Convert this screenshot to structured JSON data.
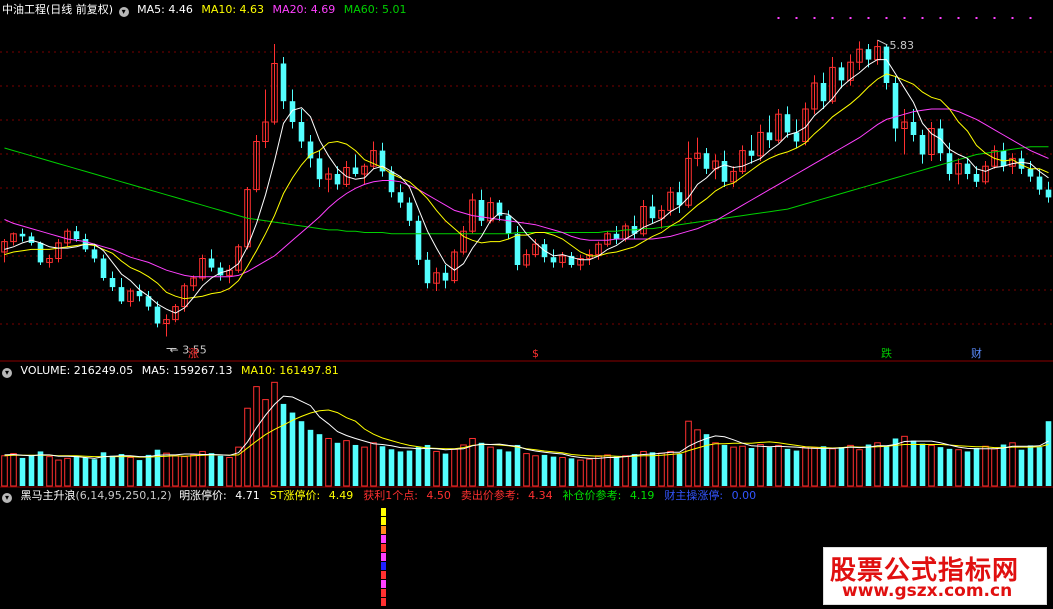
{
  "header": {
    "stock_name": "中油工程",
    "period": "(日线 前复权)",
    "ma5_label": "MA5:",
    "ma5_value": "4.46",
    "ma10_label": "MA10:",
    "ma10_value": "4.63",
    "ma20_label": "MA20:",
    "ma20_value": "4.69",
    "ma60_label": "MA60:",
    "ma60_value": "5.01",
    "high_label": "5.83",
    "low_label": "3.55"
  },
  "markers": [
    {
      "text": "涨",
      "color": "#ff3030"
    },
    {
      "text": "$",
      "color": "#ff3030"
    },
    {
      "text": "跌",
      "color": "#00c800"
    },
    {
      "text": "财",
      "color": "#5a8cff"
    }
  ],
  "volume_header": {
    "label": "VOLUME:",
    "value": "216249.05",
    "ma5_label": "MA5:",
    "ma5_value": "159267.13",
    "ma10_label": "MA10:",
    "ma10_value": "161497.81"
  },
  "indicator_header": {
    "name": "黑马主升浪",
    "params": "(6,14,95,250,1,2)",
    "items": [
      {
        "label": "明涨停价:",
        "value": "4.71",
        "color": "#ffffff"
      },
      {
        "label": "ST涨停价:",
        "value": "4.49",
        "color": "#ffff00"
      },
      {
        "label": "获利1个点:",
        "value": "4.50",
        "color": "#ff3030"
      },
      {
        "label": "卖出价参考:",
        "value": "4.34",
        "color": "#ff3030"
      },
      {
        "label": "补仓价参考:",
        "value": "4.19",
        "color": "#00e000"
      },
      {
        "label": "财主操涨停:",
        "value": "0.00",
        "color": "#3355ff"
      }
    ]
  },
  "watermark": {
    "line1": "股票公式指标网",
    "line2": "www.gszx.com.cn"
  },
  "colors": {
    "up": "#ff3030",
    "down": "#54ffff",
    "ma5": "#ffffff",
    "ma10": "#ffff00",
    "ma20": "#ff40ff",
    "ma60": "#00d000",
    "grid": "#7a0000"
  },
  "chart_data": {
    "type": "candlestick",
    "price_range": [
      3.4,
      6.0
    ],
    "ohlc": [
      [
        4.2,
        4.3,
        4.12,
        4.28
      ],
      [
        4.28,
        4.35,
        4.25,
        4.34
      ],
      [
        4.34,
        4.38,
        4.28,
        4.32
      ],
      [
        4.32,
        4.35,
        4.25,
        4.27
      ],
      [
        4.27,
        4.28,
        4.1,
        4.12
      ],
      [
        4.12,
        4.18,
        4.08,
        4.15
      ],
      [
        4.15,
        4.3,
        4.12,
        4.27
      ],
      [
        4.27,
        4.38,
        4.24,
        4.36
      ],
      [
        4.36,
        4.4,
        4.28,
        4.3
      ],
      [
        4.3,
        4.34,
        4.2,
        4.22
      ],
      [
        4.22,
        4.26,
        4.12,
        4.15
      ],
      [
        4.15,
        4.18,
        3.98,
        4.0
      ],
      [
        4.0,
        4.05,
        3.9,
        3.93
      ],
      [
        3.93,
        4.0,
        3.8,
        3.82
      ],
      [
        3.82,
        3.92,
        3.78,
        3.9
      ],
      [
        3.9,
        3.95,
        3.82,
        3.86
      ],
      [
        3.86,
        3.9,
        3.75,
        3.78
      ],
      [
        3.78,
        3.82,
        3.62,
        3.65
      ],
      [
        3.65,
        3.72,
        3.55,
        3.68
      ],
      [
        3.68,
        3.8,
        3.66,
        3.78
      ],
      [
        3.78,
        3.96,
        3.74,
        3.94
      ],
      [
        3.94,
        4.02,
        3.9,
        4.0
      ],
      [
        4.0,
        4.18,
        3.98,
        4.15
      ],
      [
        4.15,
        4.22,
        4.05,
        4.08
      ],
      [
        4.08,
        4.12,
        3.98,
        4.02
      ],
      [
        4.02,
        4.1,
        3.96,
        4.06
      ],
      [
        4.06,
        4.26,
        4.04,
        4.24
      ],
      [
        4.24,
        4.7,
        4.22,
        4.68
      ],
      [
        4.68,
        5.1,
        4.66,
        5.05
      ],
      [
        5.05,
        5.45,
        5.0,
        5.2
      ],
      [
        5.2,
        5.8,
        5.18,
        5.65
      ],
      [
        5.65,
        5.7,
        5.3,
        5.36
      ],
      [
        5.36,
        5.45,
        5.15,
        5.2
      ],
      [
        5.2,
        5.3,
        5.0,
        5.05
      ],
      [
        5.05,
        5.1,
        4.85,
        4.92
      ],
      [
        4.92,
        4.98,
        4.7,
        4.76
      ],
      [
        4.76,
        4.85,
        4.66,
        4.8
      ],
      [
        4.8,
        4.86,
        4.68,
        4.72
      ],
      [
        4.72,
        4.9,
        4.7,
        4.85
      ],
      [
        4.85,
        4.95,
        4.78,
        4.8
      ],
      [
        4.8,
        4.88,
        4.72,
        4.86
      ],
      [
        4.86,
        5.05,
        4.84,
        4.98
      ],
      [
        4.98,
        5.04,
        4.78,
        4.82
      ],
      [
        4.82,
        4.86,
        4.62,
        4.66
      ],
      [
        4.66,
        4.72,
        4.54,
        4.58
      ],
      [
        4.58,
        4.62,
        4.4,
        4.44
      ],
      [
        4.44,
        4.48,
        4.1,
        4.14
      ],
      [
        4.14,
        4.2,
        3.92,
        3.96
      ],
      [
        3.96,
        4.08,
        3.9,
        4.04
      ],
      [
        4.04,
        4.1,
        3.92,
        3.98
      ],
      [
        3.98,
        4.22,
        3.96,
        4.2
      ],
      [
        4.2,
        4.4,
        4.18,
        4.36
      ],
      [
        4.36,
        4.65,
        4.34,
        4.6
      ],
      [
        4.6,
        4.68,
        4.4,
        4.44
      ],
      [
        4.44,
        4.62,
        4.42,
        4.58
      ],
      [
        4.58,
        4.6,
        4.44,
        4.48
      ],
      [
        4.48,
        4.52,
        4.3,
        4.34
      ],
      [
        4.34,
        4.4,
        4.06,
        4.1
      ],
      [
        4.1,
        4.22,
        4.08,
        4.18
      ],
      [
        4.18,
        4.3,
        4.16,
        4.26
      ],
      [
        4.26,
        4.3,
        4.12,
        4.16
      ],
      [
        4.16,
        4.22,
        4.08,
        4.12
      ],
      [
        4.12,
        4.2,
        4.08,
        4.17
      ],
      [
        4.17,
        4.2,
        4.08,
        4.1
      ],
      [
        4.1,
        4.18,
        4.06,
        4.15
      ],
      [
        4.15,
        4.22,
        4.1,
        4.18
      ],
      [
        4.18,
        4.28,
        4.14,
        4.26
      ],
      [
        4.26,
        4.36,
        4.24,
        4.34
      ],
      [
        4.34,
        4.4,
        4.26,
        4.3
      ],
      [
        4.3,
        4.42,
        4.28,
        4.4
      ],
      [
        4.4,
        4.48,
        4.3,
        4.34
      ],
      [
        4.34,
        4.6,
        4.32,
        4.55
      ],
      [
        4.55,
        4.64,
        4.42,
        4.46
      ],
      [
        4.46,
        4.56,
        4.38,
        4.52
      ],
      [
        4.52,
        4.7,
        4.48,
        4.66
      ],
      [
        4.66,
        4.74,
        4.5,
        4.56
      ],
      [
        4.56,
        5.05,
        4.54,
        4.92
      ],
      [
        4.92,
        5.08,
        4.86,
        4.96
      ],
      [
        4.96,
        5.0,
        4.8,
        4.84
      ],
      [
        4.84,
        4.95,
        4.76,
        4.9
      ],
      [
        4.9,
        4.98,
        4.7,
        4.74
      ],
      [
        4.74,
        4.86,
        4.7,
        4.82
      ],
      [
        4.82,
        5.02,
        4.8,
        4.98
      ],
      [
        4.98,
        5.1,
        4.88,
        4.94
      ],
      [
        4.94,
        5.18,
        4.9,
        5.12
      ],
      [
        5.12,
        5.25,
        5.0,
        5.06
      ],
      [
        5.06,
        5.3,
        5.04,
        5.26
      ],
      [
        5.26,
        5.32,
        5.08,
        5.12
      ],
      [
        5.12,
        5.22,
        5.0,
        5.05
      ],
      [
        5.05,
        5.35,
        5.02,
        5.3
      ],
      [
        5.3,
        5.56,
        5.26,
        5.5
      ],
      [
        5.5,
        5.58,
        5.3,
        5.36
      ],
      [
        5.36,
        5.7,
        5.34,
        5.62
      ],
      [
        5.62,
        5.66,
        5.46,
        5.52
      ],
      [
        5.52,
        5.72,
        5.48,
        5.66
      ],
      [
        5.66,
        5.82,
        5.6,
        5.76
      ],
      [
        5.76,
        5.8,
        5.62,
        5.68
      ],
      [
        5.68,
        5.83,
        5.64,
        5.78
      ],
      [
        5.78,
        5.8,
        5.45,
        5.5
      ],
      [
        5.5,
        5.55,
        5.05,
        5.15
      ],
      [
        5.15,
        5.3,
        4.95,
        5.2
      ],
      [
        5.2,
        5.3,
        5.05,
        5.1
      ],
      [
        5.1,
        5.14,
        4.88,
        4.95
      ],
      [
        4.95,
        5.2,
        4.9,
        5.15
      ],
      [
        5.15,
        5.22,
        4.9,
        4.96
      ],
      [
        4.96,
        5.04,
        4.75,
        4.8
      ],
      [
        4.8,
        4.92,
        4.72,
        4.88
      ],
      [
        4.88,
        4.92,
        4.76,
        4.8
      ],
      [
        4.8,
        4.86,
        4.7,
        4.74
      ],
      [
        4.74,
        4.9,
        4.72,
        4.86
      ],
      [
        4.86,
        5.02,
        4.84,
        4.98
      ],
      [
        4.98,
        5.04,
        4.82,
        4.86
      ],
      [
        4.86,
        4.96,
        4.8,
        4.92
      ],
      [
        4.92,
        4.98,
        4.8,
        4.84
      ],
      [
        4.84,
        4.9,
        4.74,
        4.78
      ],
      [
        4.78,
        4.84,
        4.64,
        4.68
      ],
      [
        4.68,
        4.74,
        4.58,
        4.62
      ]
    ],
    "ma5_values": [
      4.22,
      4.24,
      4.27,
      4.29,
      4.27,
      4.24,
      4.23,
      4.23,
      4.24,
      4.26,
      4.26,
      4.21,
      4.12,
      4.03,
      3.98,
      3.91,
      3.86,
      3.8,
      3.76,
      3.73,
      3.77,
      3.85,
      3.94,
      4.0,
      4.04,
      4.06,
      4.11,
      4.24,
      4.42,
      4.64,
      4.9,
      5.19,
      5.29,
      5.31,
      5.24,
      5.06,
      4.94,
      4.84,
      4.78,
      4.76,
      4.77,
      4.84,
      4.86,
      4.82,
      4.78,
      4.7,
      4.53,
      4.36,
      4.23,
      4.11,
      4.06,
      4.11,
      4.23,
      4.32,
      4.44,
      4.5,
      4.49,
      4.43,
      4.34,
      4.27,
      4.21,
      4.17,
      4.18,
      4.16,
      4.14,
      4.14,
      4.17,
      4.22,
      4.25,
      4.3,
      4.34,
      4.39,
      4.42,
      4.45,
      4.51,
      4.55,
      4.62,
      4.72,
      4.77,
      4.84,
      4.87,
      4.85,
      4.86,
      4.89,
      4.92,
      4.98,
      5.03,
      5.1,
      5.12,
      5.16,
      5.25,
      5.31,
      5.38,
      5.47,
      5.53,
      5.58,
      5.64,
      5.68,
      5.68,
      5.57,
      5.46,
      5.35,
      5.19,
      5.11,
      5.07,
      4.99,
      4.95,
      4.92,
      4.84,
      4.82,
      4.85,
      4.86,
      4.88,
      4.89,
      4.88,
      4.82,
      4.77
    ],
    "ma10_values": [
      4.18,
      4.2,
      4.21,
      4.22,
      4.22,
      4.22,
      4.23,
      4.24,
      4.25,
      4.26,
      4.25,
      4.22,
      4.19,
      4.13,
      4.08,
      4.05,
      4.01,
      3.96,
      3.89,
      3.86,
      3.84,
      3.85,
      3.86,
      3.88,
      3.89,
      3.92,
      3.98,
      4.09,
      4.21,
      4.34,
      4.48,
      4.65,
      4.77,
      4.87,
      4.95,
      4.98,
      5.04,
      5.05,
      5.03,
      4.98,
      4.91,
      4.88,
      4.85,
      4.8,
      4.77,
      4.74,
      4.68,
      4.61,
      4.52,
      4.44,
      4.38,
      4.32,
      4.29,
      4.27,
      4.28,
      4.28,
      4.3,
      4.33,
      4.33,
      4.35,
      4.35,
      4.33,
      4.3,
      4.25,
      4.2,
      4.17,
      4.17,
      4.19,
      4.2,
      4.22,
      4.24,
      4.28,
      4.32,
      4.35,
      4.4,
      4.44,
      4.5,
      4.56,
      4.61,
      4.67,
      4.71,
      4.73,
      4.78,
      4.83,
      4.88,
      4.92,
      4.95,
      4.97,
      5.0,
      5.04,
      5.11,
      5.17,
      5.24,
      5.29,
      5.34,
      5.4,
      5.47,
      5.53,
      5.57,
      5.55,
      5.52,
      5.49,
      5.43,
      5.39,
      5.37,
      5.3,
      5.2,
      5.13,
      5.02,
      4.96,
      4.92,
      4.9,
      4.91,
      4.87,
      4.84,
      4.84,
      4.81
    ],
    "ma20_values": [
      4.45,
      4.42,
      4.4,
      4.38,
      4.36,
      4.34,
      4.32,
      4.3,
      4.29,
      4.28,
      4.26,
      4.24,
      4.22,
      4.19,
      4.16,
      4.14,
      4.12,
      4.09,
      4.06,
      4.04,
      4.02,
      4.01,
      4.01,
      4.01,
      4.01,
      4.01,
      4.02,
      4.05,
      4.09,
      4.13,
      4.17,
      4.23,
      4.29,
      4.35,
      4.41,
      4.47,
      4.54,
      4.6,
      4.65,
      4.69,
      4.72,
      4.74,
      4.75,
      4.75,
      4.74,
      4.71,
      4.68,
      4.64,
      4.6,
      4.56,
      4.52,
      4.5,
      4.48,
      4.47,
      4.46,
      4.45,
      4.44,
      4.43,
      4.42,
      4.41,
      4.39,
      4.37,
      4.35,
      4.32,
      4.3,
      4.29,
      4.29,
      4.29,
      4.3,
      4.3,
      4.3,
      4.3,
      4.3,
      4.31,
      4.32,
      4.34,
      4.36,
      4.38,
      4.41,
      4.44,
      4.48,
      4.52,
      4.56,
      4.6,
      4.64,
      4.68,
      4.72,
      4.76,
      4.8,
      4.84,
      4.88,
      4.92,
      4.96,
      5.0,
      5.04,
      5.08,
      5.13,
      5.18,
      5.22,
      5.24,
      5.26,
      5.28,
      5.29,
      5.3,
      5.3,
      5.3,
      5.28,
      5.25,
      5.22,
      5.18,
      5.14,
      5.1,
      5.06,
      5.02,
      4.98,
      4.95,
      4.92
    ],
    "ma60_values": [
      5.0,
      4.98,
      4.96,
      4.94,
      4.92,
      4.9,
      4.88,
      4.86,
      4.84,
      4.82,
      4.8,
      4.78,
      4.76,
      4.74,
      4.72,
      4.7,
      4.68,
      4.66,
      4.64,
      4.62,
      4.6,
      4.58,
      4.56,
      4.54,
      4.52,
      4.5,
      4.48,
      4.46,
      4.45,
      4.44,
      4.43,
      4.42,
      4.41,
      4.4,
      4.39,
      4.38,
      4.37,
      4.37,
      4.36,
      4.36,
      4.35,
      4.35,
      4.35,
      4.34,
      4.34,
      4.34,
      4.34,
      4.34,
      4.34,
      4.34,
      4.34,
      4.34,
      4.34,
      4.34,
      4.34,
      4.34,
      4.34,
      4.35,
      4.35,
      4.35,
      4.35,
      4.35,
      4.35,
      4.35,
      4.35,
      4.35,
      4.35,
      4.36,
      4.36,
      4.37,
      4.37,
      4.38,
      4.38,
      4.39,
      4.4,
      4.41,
      4.42,
      4.43,
      4.44,
      4.45,
      4.46,
      4.47,
      4.48,
      4.49,
      4.5,
      4.51,
      4.52,
      4.53,
      4.55,
      4.57,
      4.59,
      4.61,
      4.63,
      4.65,
      4.67,
      4.69,
      4.71,
      4.73,
      4.75,
      4.77,
      4.79,
      4.81,
      4.83,
      4.85,
      4.87,
      4.89,
      4.91,
      4.93,
      4.95,
      4.96,
      4.97,
      4.98,
      4.99,
      5.0,
      5.01,
      5.01,
      5.01
    ],
    "volume": [
      70,
      75,
      65,
      72,
      80,
      68,
      60,
      64,
      70,
      66,
      62,
      78,
      70,
      74,
      66,
      60,
      72,
      84,
      76,
      70,
      68,
      72,
      80,
      76,
      70,
      66,
      90,
      180,
      230,
      200,
      240,
      190,
      170,
      150,
      130,
      120,
      110,
      100,
      105,
      95,
      90,
      100,
      92,
      85,
      80,
      82,
      90,
      95,
      80,
      75,
      85,
      95,
      110,
      100,
      90,
      85,
      80,
      95,
      75,
      70,
      72,
      68,
      66,
      64,
      60,
      62,
      70,
      72,
      68,
      70,
      74,
      80,
      78,
      76,
      80,
      74,
      150,
      130,
      120,
      100,
      95,
      90,
      92,
      88,
      96,
      90,
      94,
      86,
      82,
      90,
      88,
      92,
      86,
      90,
      94,
      84,
      96,
      100,
      92,
      110,
      115,
      105,
      98,
      94,
      90,
      86,
      84,
      80,
      88,
      92,
      86,
      96,
      100,
      84,
      94,
      90,
      150
    ],
    "volume_ma5": [
      72,
      73,
      71,
      70,
      72,
      72,
      69,
      69,
      68,
      66,
      64,
      68,
      69,
      70,
      70,
      68,
      68,
      71,
      72,
      72,
      74,
      74,
      73,
      73,
      72,
      71,
      77,
      102,
      135,
      164,
      189,
      208,
      206,
      196,
      186,
      160,
      144,
      126,
      117,
      110,
      104,
      98,
      96,
      93,
      89,
      88,
      86,
      87,
      86,
      84,
      85,
      86,
      93,
      97,
      96,
      97,
      94,
      92,
      85,
      81,
      78,
      76,
      74,
      69,
      66,
      64,
      64,
      66,
      66,
      68,
      71,
      73,
      74,
      76,
      78,
      78,
      92,
      102,
      110,
      116,
      114,
      107,
      99,
      93,
      92,
      91,
      92,
      91,
      90,
      88,
      87,
      87,
      87,
      88,
      90,
      89,
      90,
      93,
      93,
      96,
      103,
      104,
      104,
      104,
      100,
      95,
      90,
      87,
      86,
      86,
      86,
      88,
      92,
      92,
      92,
      93,
      104
    ],
    "volume_ma10": [
      70,
      71,
      71,
      71,
      71,
      71,
      70,
      70,
      70,
      69,
      68,
      68,
      68,
      68,
      68,
      67,
      67,
      68,
      69,
      70,
      69,
      70,
      71,
      72,
      72,
      71,
      72,
      88,
      104,
      119,
      131,
      141,
      152,
      161,
      169,
      174,
      176,
      170,
      158,
      150,
      132,
      120,
      111,
      105,
      99,
      94,
      91,
      88,
      87,
      86,
      86,
      89,
      94,
      96,
      96,
      95,
      93,
      90,
      86,
      84,
      81,
      79,
      77,
      73,
      71,
      70,
      69,
      70,
      69,
      68,
      69,
      70,
      70,
      71,
      73,
      75,
      82,
      88,
      94,
      98,
      98,
      99,
      99,
      99,
      101,
      102,
      100,
      97,
      94,
      91,
      90,
      89,
      88,
      89,
      91,
      90,
      90,
      91,
      92,
      94,
      96,
      96,
      96,
      96,
      96,
      95,
      93,
      92,
      91,
      91,
      89,
      89,
      90,
      90,
      90,
      91,
      96
    ],
    "indicator_bars": [
      "#ffff00",
      "#ffff00",
      "#ff8c1a",
      "#ff40ff",
      "#ff3030",
      "#ff40ff",
      "#2020ff",
      "#ff3030",
      "#ff40ff",
      "#ff3030",
      "#ff3030"
    ]
  }
}
